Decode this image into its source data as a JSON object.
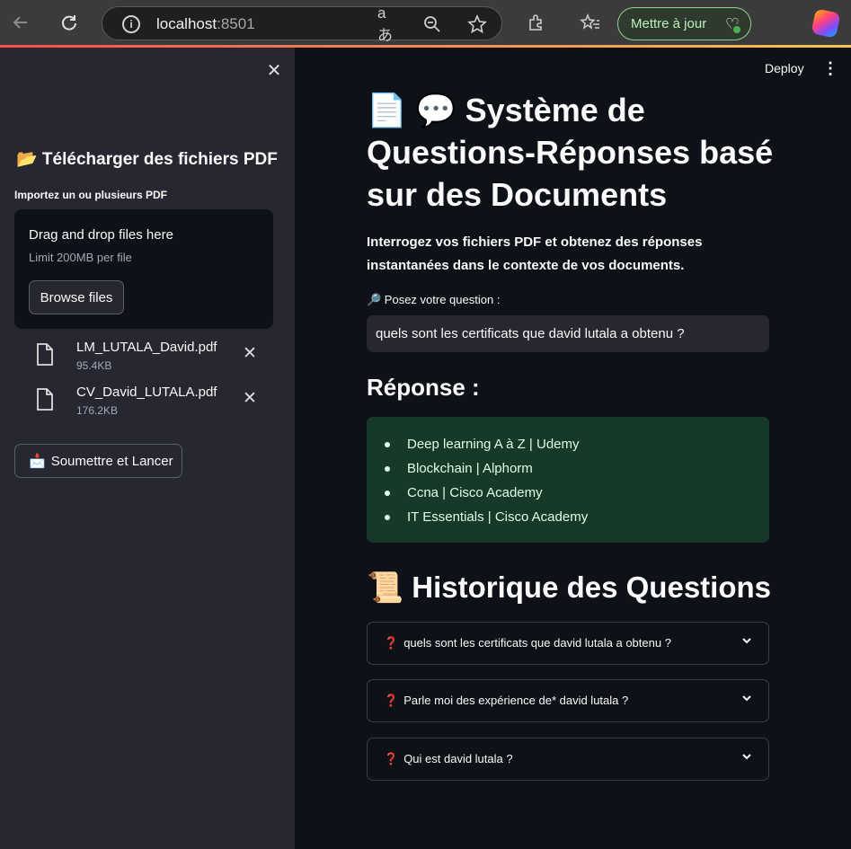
{
  "browser": {
    "url_host": "localhost",
    "url_port": ":8501",
    "update_label": "Mettre à jour"
  },
  "sidebar": {
    "header": "📂 Télécharger des fichiers PDF",
    "upload_label": "Importez un ou plusieurs PDF",
    "dropzone_title": "Drag and drop files here",
    "dropzone_limit": "Limit 200MB per file",
    "browse_label": "Browse files",
    "files": [
      {
        "name": "LM_LUTALA_David.pdf",
        "size": "95.4KB"
      },
      {
        "name": "CV_David_LUTALA.pdf",
        "size": "176.2KB"
      }
    ],
    "submit_label": "Soumettre et Lancer",
    "submit_icon": "📩"
  },
  "main": {
    "deploy_label": "Deploy",
    "title": "📄 💬 Système de Questions-Réponses basé sur des Documents",
    "subtitle": "Interrogez vos fichiers PDF et obtenez des réponses instantanées dans le contexte de vos documents.",
    "question_label": "🔎 Posez votre question :",
    "question_value": "quels sont les certificats que david lutala a obtenu ?",
    "response_title": "Réponse :",
    "response_items": [
      "Deep learning A à Z | Udemy",
      "Blockchain | Alphorm",
      "Ccna | Cisco Academy",
      "IT Essentials | Cisco Academy"
    ],
    "history_title": "📜 Historique des Questions",
    "history": [
      "quels sont les certificats que david lutala a obtenu ?",
      "Parle moi des expérience de* david lutala ?",
      "Qui est david lutala ?"
    ],
    "history_mark": "❓"
  },
  "colors": {
    "sidebar_bg": "#262730",
    "main_bg": "#0e1117",
    "success_bg": "#173928",
    "success_text": "#dffde9"
  }
}
